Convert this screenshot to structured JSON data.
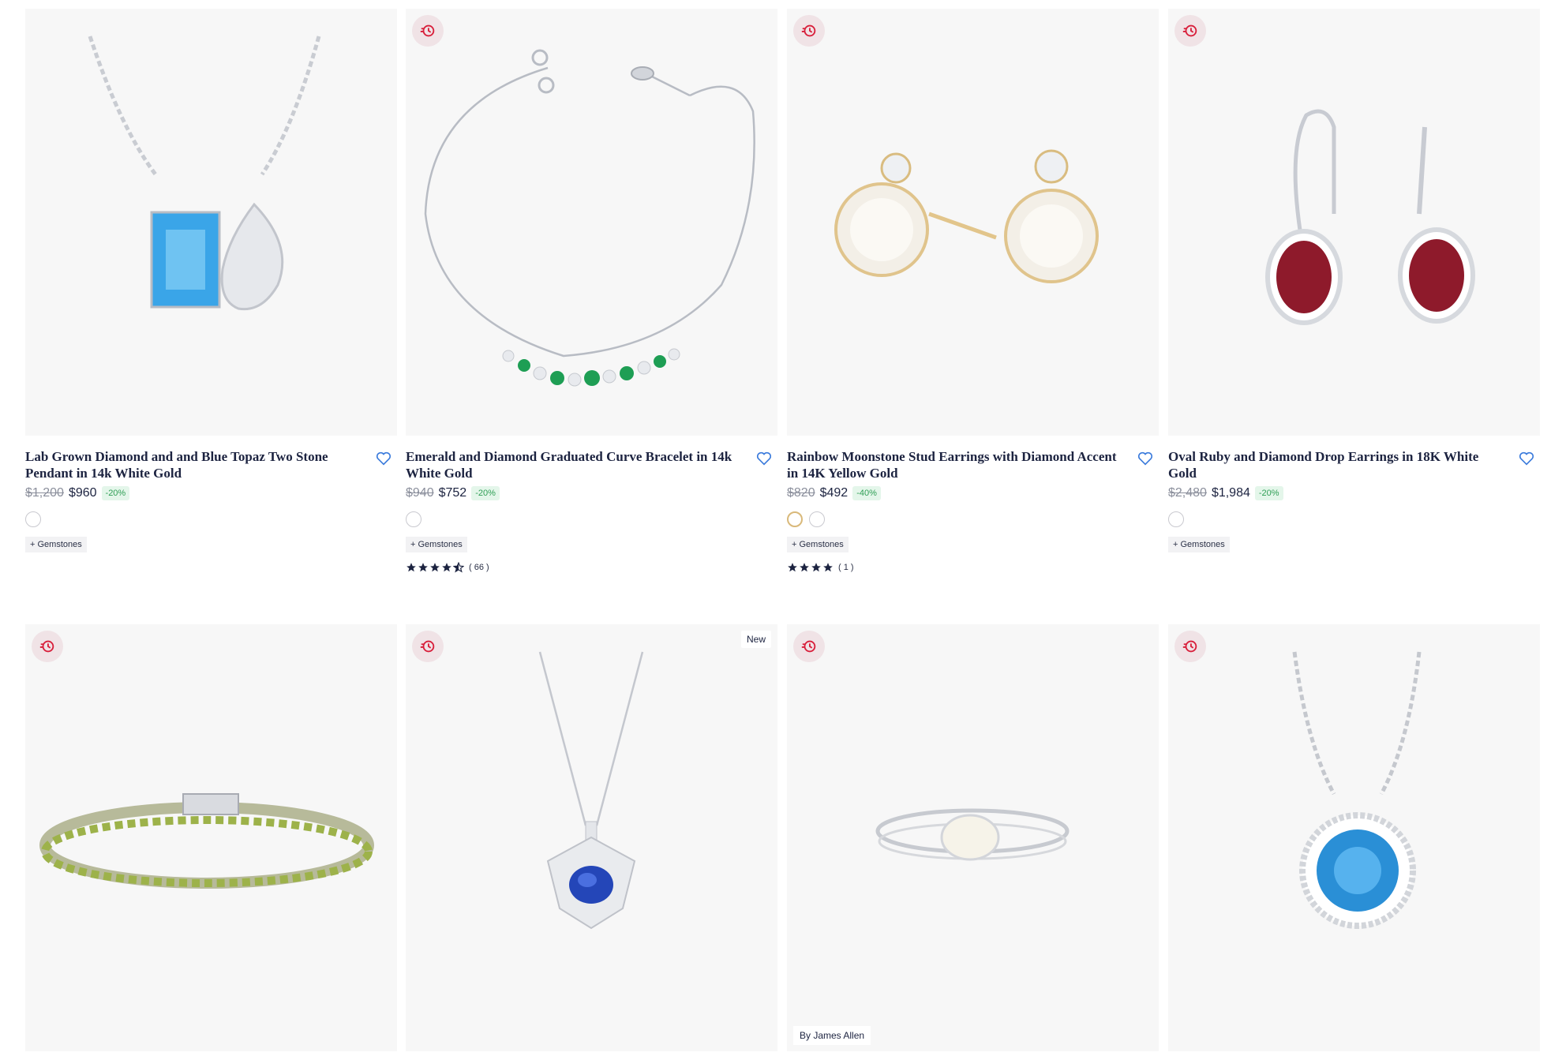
{
  "products": [
    {
      "title": "Lab Grown Diamond and and Blue Topaz Two Stone Pendant in 14k White Gold",
      "old_price": "$1,200",
      "price": "$960",
      "discount": "-20%",
      "tag": "+ Gemstones",
      "metal_swatches": [
        "white"
      ],
      "rating": null,
      "reviews": null,
      "sale_badge": false,
      "badge": null,
      "icon": "pendant-image"
    },
    {
      "title": "Emerald and Diamond Graduated Curve Bracelet in 14k White Gold",
      "old_price": "$940",
      "price": "$752",
      "discount": "-20%",
      "tag": "+ Gemstones",
      "metal_swatches": [
        "white"
      ],
      "rating": 4.5,
      "reviews": "( 66 )",
      "sale_badge": true,
      "badge": null,
      "icon": "bracelet-image"
    },
    {
      "title": "Rainbow Moonstone Stud Earrings with Diamond Accent in 14K Yellow Gold",
      "old_price": "$820",
      "price": "$492",
      "discount": "-40%",
      "tag": "+ Gemstones",
      "metal_swatches": [
        "yellow",
        "white"
      ],
      "rating": 4,
      "reviews": "( 1 )",
      "sale_badge": true,
      "badge": null,
      "icon": "earrings-image"
    },
    {
      "title": "Oval Ruby and Diamond Drop Earrings in 18K White Gold",
      "old_price": "$2,480",
      "price": "$1,984",
      "discount": "-20%",
      "tag": "+ Gemstones",
      "metal_swatches": [
        "white"
      ],
      "rating": null,
      "reviews": null,
      "sale_badge": true,
      "badge": null,
      "icon": "drop-earrings-image"
    },
    {
      "sale_badge": true,
      "badge": null,
      "icon": "tennis-bracelet-image"
    },
    {
      "sale_badge": true,
      "badge": "New",
      "icon": "sapphire-pendant-image"
    },
    {
      "sale_badge": true,
      "badge": "By James Allen",
      "icon": "opal-ring-image"
    },
    {
      "sale_badge": true,
      "badge": null,
      "icon": "topaz-halo-pendant-image"
    }
  ],
  "colors": {
    "text": "#1c2340",
    "discount_bg": "#e4f6ea",
    "discount_text": "#2f9e55",
    "sale_icon": "#d81e3a",
    "heart": "#3b7bdc"
  }
}
